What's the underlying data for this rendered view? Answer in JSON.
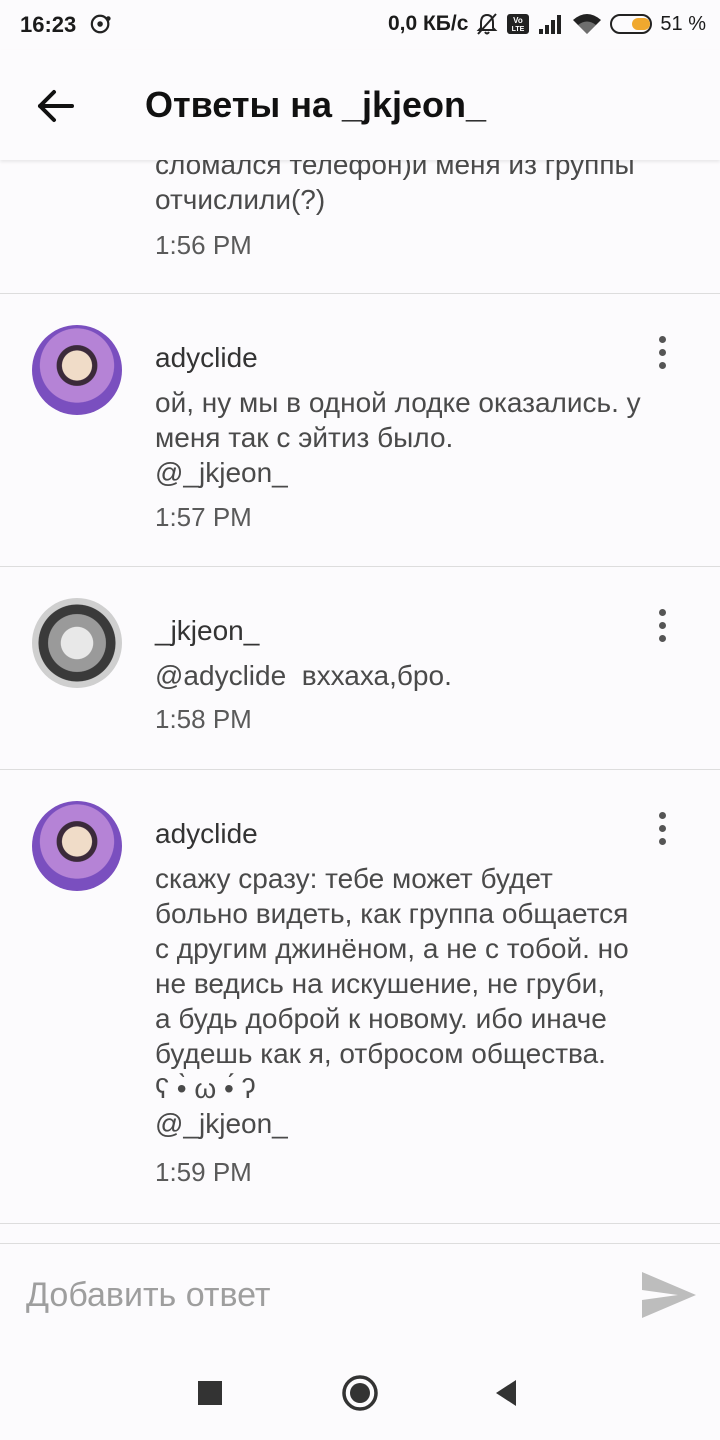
{
  "status_bar": {
    "time": "16:23",
    "network_speed": "0,0 КБ/с",
    "battery_percent": "51 %",
    "battery_level": 0.51,
    "icons": [
      "disc-icon",
      "bell-off-icon",
      "volte-icon",
      "signal-icon",
      "wifi-icon",
      "battery-icon"
    ]
  },
  "header": {
    "title": "Ответы на _jkjeon_",
    "back_icon": "arrow-left-icon"
  },
  "partial_comment": {
    "text": "сломался телефон)и меня из группы\nотчислили(?)",
    "time": "1:56 PM"
  },
  "comments": [
    {
      "username": "adyclide",
      "text": "ой, ну мы в одной лодке оказались. у\nменя так с эйтиз было.\n@_jkjeon_",
      "time": "1:57 PM"
    },
    {
      "username": "_jkjeon_",
      "text": "@adyclide  вххаха,бро.",
      "time": "1:58 PM"
    },
    {
      "username": "adyclide",
      "text": "скажу сразу: тебе может будет\nбольно видеть, как группа общается\nс другим джинёном, а не с тобой. но\nне ведись на искушение, не груби,\nа будь доброй к новому. ибо иначе\nбудешь как я, отбросом общества.\nʕ •̀ ω •́ ʔ\n@_jkjeon_",
      "time": "1:59 PM"
    }
  ],
  "composer": {
    "placeholder": "Добавить ответ",
    "send_icon": "send-icon"
  },
  "nav_bar": {
    "icons": [
      "recents-square-icon",
      "home-circle-icon",
      "back-triangle-icon"
    ]
  },
  "colors": {
    "background": "#fcfbfd",
    "text_primary": "#111111",
    "text_secondary": "#4a4a4a",
    "divider": "#dddddd",
    "battery_fill": "#f0a82e",
    "send_icon": "#bdbdbd"
  }
}
